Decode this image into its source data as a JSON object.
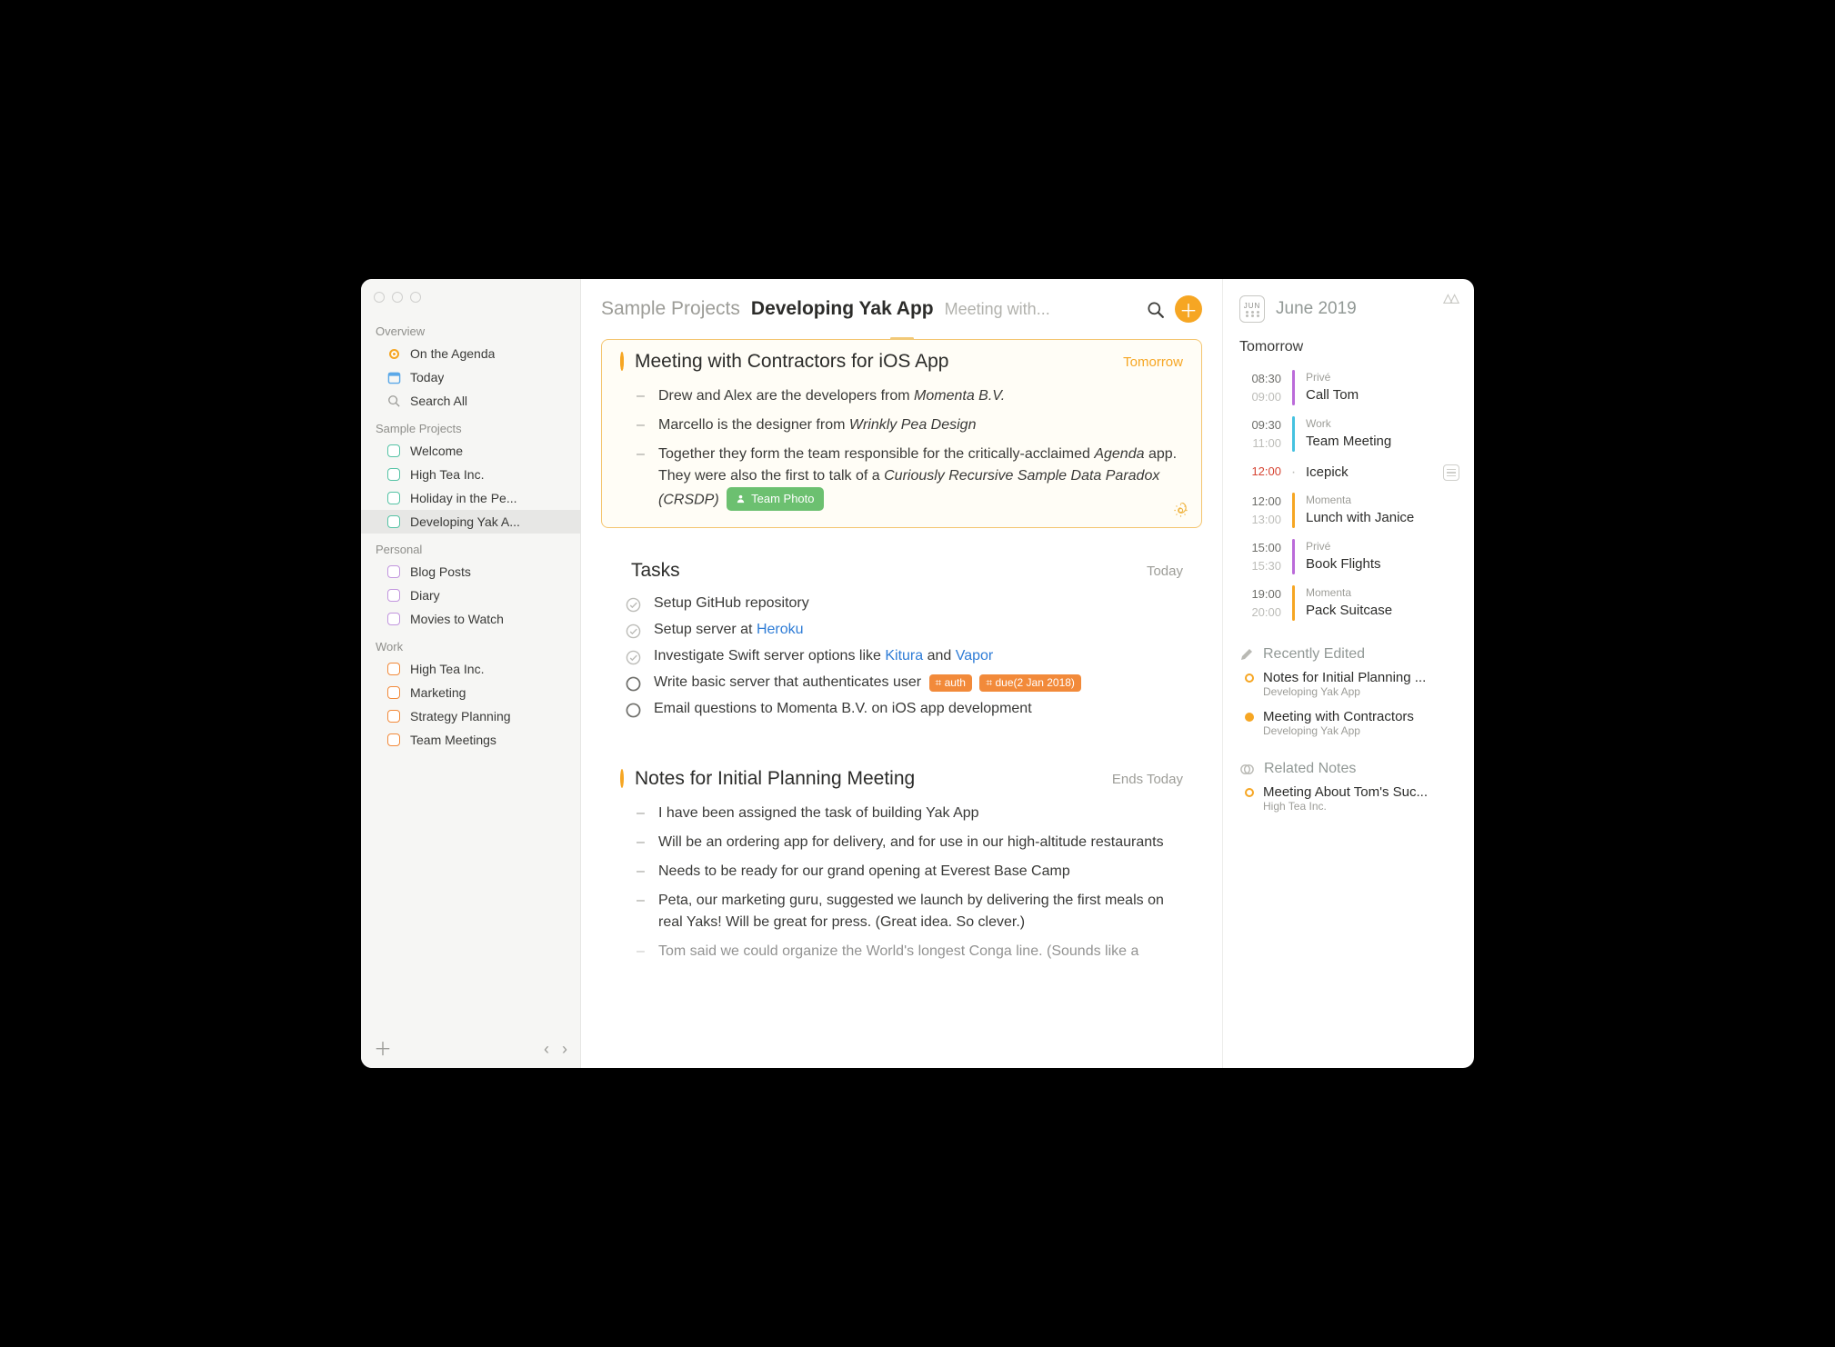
{
  "sidebar": {
    "overview_label": "Overview",
    "items_overview": [
      {
        "label": "On the Agenda",
        "icon": "agenda"
      },
      {
        "label": "Today",
        "icon": "today"
      },
      {
        "label": "Search All",
        "icon": "search"
      }
    ],
    "sample_label": "Sample Projects",
    "items_sample": [
      {
        "label": "Welcome"
      },
      {
        "label": "High Tea Inc."
      },
      {
        "label": "Holiday in the Pe..."
      },
      {
        "label": "Developing Yak A..."
      }
    ],
    "personal_label": "Personal",
    "items_personal": [
      {
        "label": "Blog Posts"
      },
      {
        "label": "Diary"
      },
      {
        "label": "Movies to Watch"
      }
    ],
    "work_label": "Work",
    "items_work": [
      {
        "label": "High Tea Inc."
      },
      {
        "label": "Marketing"
      },
      {
        "label": "Strategy Planning"
      },
      {
        "label": "Team Meetings"
      }
    ]
  },
  "header": {
    "project": "Sample Projects",
    "note": "Developing Yak App",
    "sub": "Meeting with..."
  },
  "note1": {
    "title": "Meeting with Contractors for iOS App",
    "date": "Tomorrow",
    "b1_a": "Drew and Alex are the developers from ",
    "b1_b": "Momenta B.V.",
    "b2_a": "Marcello is the designer from ",
    "b2_b": "Wrinkly Pea Design",
    "b3_a": "Together they form the team responsible for the critically-acclaimed ",
    "b3_b": "Agenda",
    "b3_c": " app. They were also the first to talk of a ",
    "b3_d": "Curiously Recursive Sample Data Paradox (CRSDP)",
    "pill": "Team Photo"
  },
  "note2": {
    "title": "Tasks",
    "date": "Today",
    "t1": "Setup GitHub repository",
    "t2_a": "Setup server at ",
    "t2_b": "Heroku",
    "t3_a": "Investigate Swift server options like ",
    "t3_b": "Kitura",
    "t3_c": " and ",
    "t3_d": "Vapor",
    "t4": "Write basic server that authenticates user",
    "t4_tag1": "⌗ auth",
    "t4_tag2": "⌗ due(2 Jan 2018)",
    "t5": "Email questions to Momenta B.V. on iOS app development"
  },
  "note3": {
    "title": "Notes for Initial Planning Meeting",
    "date": "Ends Today",
    "b1": "I have been assigned the task of building Yak App",
    "b2": "Will be an ordering app for delivery, and for use in our high-altitude restaurants",
    "b3": "Needs to be ready for our grand opening at Everest Base Camp",
    "b4": "Peta, our marketing guru, suggested we launch by delivering the first meals on real Yaks! Will be great for press. (Great idea. So clever.)",
    "b5": "Tom said we could organize the World's longest Conga line. (Sounds like a"
  },
  "panel": {
    "cal_badge": "JUN",
    "month": "June 2019",
    "tomorrow": "Tomorrow",
    "events": [
      {
        "t1": "08:30",
        "t2": "09:00",
        "cal": "Privé",
        "title": "Call Tom",
        "bar": "#bb6bd9"
      },
      {
        "t1": "09:30",
        "t2": "11:00",
        "cal": "Work",
        "title": "Team Meeting",
        "bar": "#45c2e0"
      },
      {
        "t1": "12:00",
        "t2": "",
        "cal": "",
        "title": "Icepick",
        "bar": "",
        "red": true,
        "badge": true
      },
      {
        "t1": "12:00",
        "t2": "13:00",
        "cal": "Momenta",
        "title": "Lunch with Janice",
        "bar": "#f6a623"
      },
      {
        "t1": "15:00",
        "t2": "15:30",
        "cal": "Privé",
        "title": "Book Flights",
        "bar": "#bb6bd9"
      },
      {
        "t1": "19:00",
        "t2": "20:00",
        "cal": "Momenta",
        "title": "Pack Suitcase",
        "bar": "#f6a623"
      }
    ],
    "recent_label": "Recently Edited",
    "recent": [
      {
        "title": "Notes for Initial Planning ...",
        "proj": "Developing Yak App",
        "dot": "hollow"
      },
      {
        "title": "Meeting with Contractors",
        "proj": "Developing Yak App",
        "dot": "solid"
      }
    ],
    "related_label": "Related Notes",
    "related": [
      {
        "title": "Meeting About Tom's Suc...",
        "proj": "High Tea Inc.",
        "dot": "hollow"
      }
    ]
  }
}
